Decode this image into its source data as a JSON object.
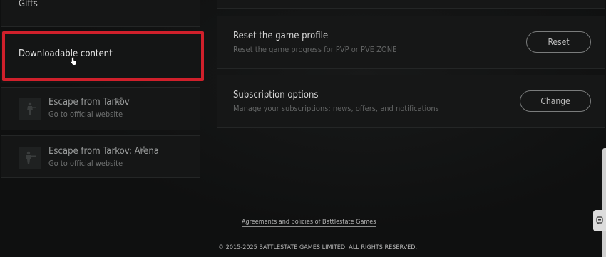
{
  "sidebar": {
    "gifts_label": "Gifts",
    "dlc_label": "Downloadable content",
    "games": [
      {
        "title": "Escape from Tarkov",
        "subtitle": "Go to official website",
        "icon": "soldier-icon"
      },
      {
        "title": "Escape from Tarkov: Arena",
        "subtitle": "Go to official website",
        "icon": "arena-soldier-icon"
      }
    ]
  },
  "settings": {
    "reset": {
      "title": "Reset the game profile",
      "description": "Reset the game progress for PVP or PVE ZONE",
      "button": "Reset"
    },
    "subscription": {
      "title": "Subscription options",
      "description": "Manage your subscriptions: news, offers, and notifications",
      "button": "Change"
    }
  },
  "footer": {
    "agreements_link": "Agreements and policies of Battlestate Games",
    "copyright": "© 2015-2025 BATTLESTATE GAMES LIMITED. ALL RIGHTS RESERVED."
  },
  "colors": {
    "highlight": "#d0202b",
    "background": "#0f1010",
    "panel": "#161717"
  }
}
